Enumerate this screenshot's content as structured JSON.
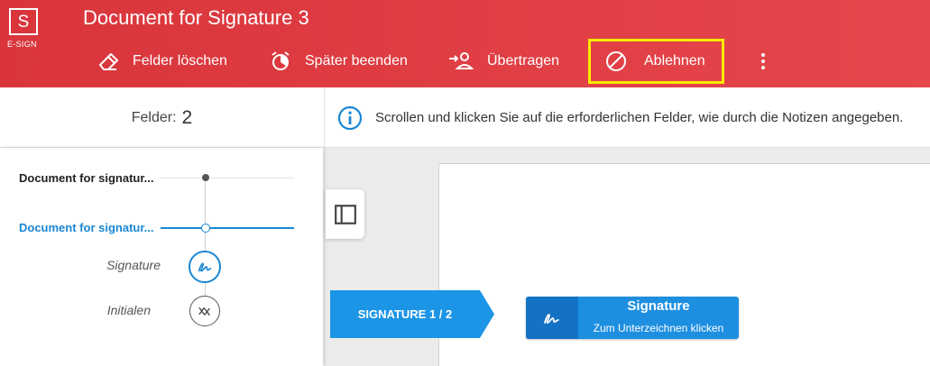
{
  "app": {
    "logo_letter": "S",
    "logo_caption": "E-SIGN",
    "document_title": "Document for Signature 3"
  },
  "toolbar": {
    "clear_fields": "Felder löschen",
    "finish_later": "Später beenden",
    "transfer": "Übertragen",
    "reject": "Ablehnen",
    "more_icon": "more-vertical-icon"
  },
  "infobar": {
    "fields_label": "Felder:",
    "fields_count": "2",
    "notice": "Scrollen und klicken Sie auf die erforderlichen Felder, wie durch die Notizen angegeben."
  },
  "navigation": {
    "documents": [
      {
        "label": "Document for signatur...",
        "active": false
      },
      {
        "label": "Document for signatur...",
        "active": true
      }
    ],
    "fields": [
      {
        "label": "Signature",
        "icon": "signature-icon",
        "status": "active"
      },
      {
        "label": "Initialen",
        "icon": "initials-icon",
        "status": "pending"
      }
    ]
  },
  "document": {
    "signature_tag": "SIGNATURE 1 / 2",
    "signature_field_title": "Signature",
    "signature_field_hint": "Zum Unterzeichnen klicken"
  },
  "colors": {
    "header": "#dc3a40",
    "accent": "#1a86d4",
    "tag": "#1c95e6",
    "highlight": "#ffea00"
  }
}
